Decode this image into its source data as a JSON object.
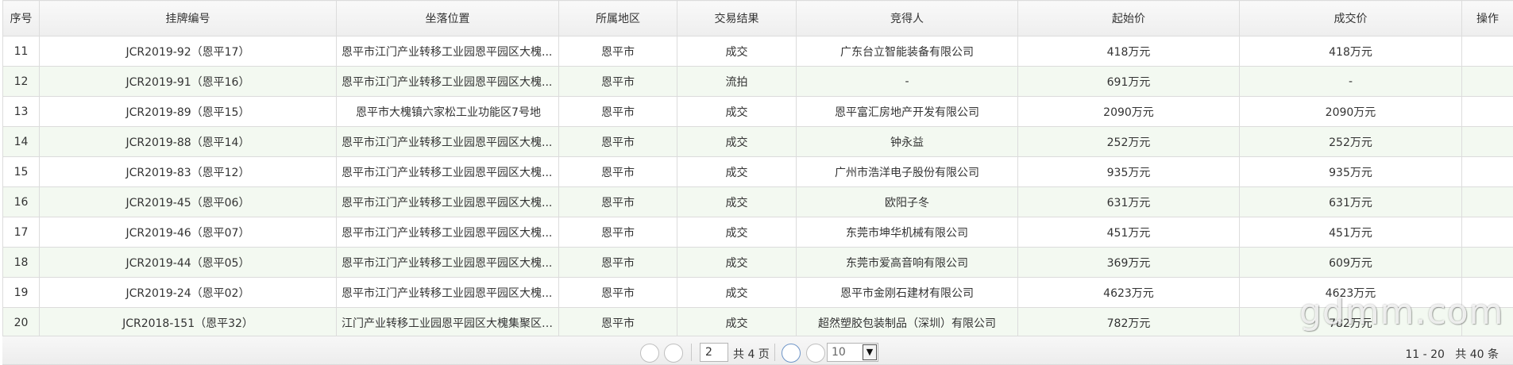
{
  "table": {
    "headers": [
      "序号",
      "挂牌编号",
      "坐落位置",
      "所属地区",
      "交易结果",
      "竞得人",
      "起始价",
      "成交价",
      "操作"
    ],
    "rows": [
      {
        "no": "11",
        "code": "JCR2019-92（恩平17）",
        "location": "恩平市江门产业转移工业园恩平园区大槐...",
        "region": "恩平市",
        "result": "成交",
        "winner": "广东台立智能装备有限公司",
        "start_price": "418万元",
        "deal_price": "418万元"
      },
      {
        "no": "12",
        "code": "JCR2019-91（恩平16）",
        "location": "恩平市江门产业转移工业园恩平园区大槐...",
        "region": "恩平市",
        "result": "流拍",
        "winner": "-",
        "start_price": "691万元",
        "deal_price": "-"
      },
      {
        "no": "13",
        "code": "JCR2019-89（恩平15）",
        "location": "恩平市大槐镇六家松工业功能区7号地",
        "region": "恩平市",
        "result": "成交",
        "winner": "恩平富汇房地产开发有限公司",
        "start_price": "2090万元",
        "deal_price": "2090万元"
      },
      {
        "no": "14",
        "code": "JCR2019-88（恩平14）",
        "location": "恩平市江门产业转移工业园恩平园区大槐...",
        "region": "恩平市",
        "result": "成交",
        "winner": "钟永益",
        "start_price": "252万元",
        "deal_price": "252万元"
      },
      {
        "no": "15",
        "code": "JCR2019-83（恩平12）",
        "location": "恩平市江门产业转移工业园恩平园区大槐...",
        "region": "恩平市",
        "result": "成交",
        "winner": "广州市浩洋电子股份有限公司",
        "start_price": "935万元",
        "deal_price": "935万元"
      },
      {
        "no": "16",
        "code": "JCR2019-45（恩平06）",
        "location": "恩平市江门产业转移工业园恩平园区大槐...",
        "region": "恩平市",
        "result": "成交",
        "winner": "欧阳子冬",
        "start_price": "631万元",
        "deal_price": "631万元"
      },
      {
        "no": "17",
        "code": "JCR2019-46（恩平07）",
        "location": "恩平市江门产业转移工业园恩平园区大槐...",
        "region": "恩平市",
        "result": "成交",
        "winner": "东莞市坤华机械有限公司",
        "start_price": "451万元",
        "deal_price": "451万元"
      },
      {
        "no": "18",
        "code": "JCR2019-44（恩平05）",
        "location": "恩平市江门产业转移工业园恩平园区大槐...",
        "region": "恩平市",
        "result": "成交",
        "winner": "东莞市爱高音响有限公司",
        "start_price": "369万元",
        "deal_price": "609万元"
      },
      {
        "no": "19",
        "code": "JCR2019-24（恩平02）",
        "location": "恩平市江门产业转移工业园恩平园区大槐...",
        "region": "恩平市",
        "result": "成交",
        "winner": "恩平市金刚石建材有限公司",
        "start_price": "4623万元",
        "deal_price": "4623万元"
      },
      {
        "no": "20",
        "code": "JCR2018-151（恩平32）",
        "location": "江门产业转移工业园恩平园区大槐集聚区4...",
        "region": "恩平市",
        "result": "成交",
        "winner": "超然塑胶包装制品（深圳）有限公司",
        "start_price": "782万元",
        "deal_price": "782万元"
      }
    ]
  },
  "pager": {
    "current_page": "2",
    "total_pages_text": "共 4 页",
    "page_size": "10",
    "range_text": "11 - 20",
    "total_records_text": "共 40 条"
  },
  "watermark": "gdmm.com",
  "colors": {
    "alt_row": "#f3f9f1",
    "header_bg": "#eeeeee",
    "border": "#dcdcdc"
  }
}
